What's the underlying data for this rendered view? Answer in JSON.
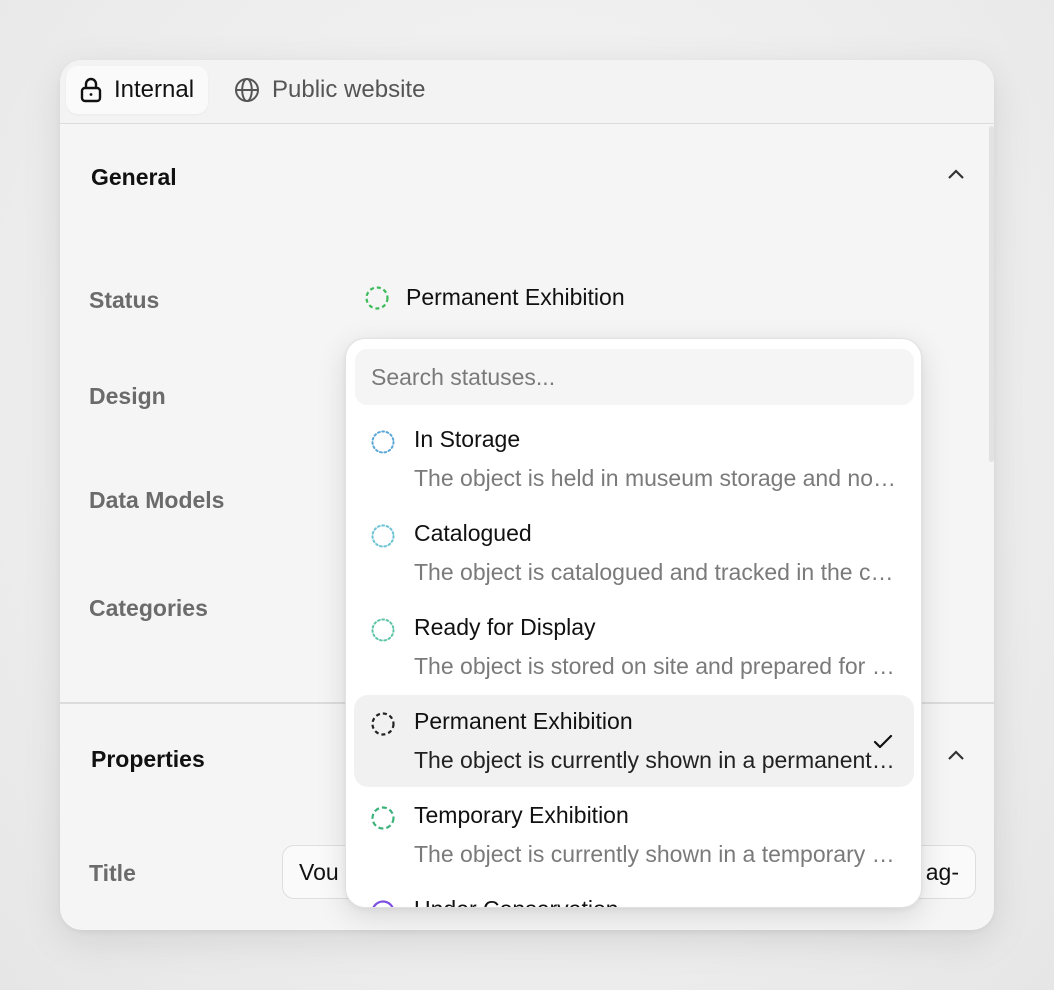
{
  "tabs": [
    {
      "label": "Internal",
      "icon": "lock-icon",
      "active": true
    },
    {
      "label": "Public website",
      "icon": "globe-icon",
      "active": false
    }
  ],
  "general": {
    "title": "General",
    "fields": {
      "status": "Status",
      "design": "Design",
      "data_models": "Data Models",
      "categories": "Categories"
    },
    "status_value": "Permanent Exhibition"
  },
  "properties": {
    "title": "Properties",
    "title_label": "Title",
    "title_value_start": "Vou",
    "title_value_end": "ag-"
  },
  "dropdown": {
    "search_placeholder": "Search statuses...",
    "options": [
      {
        "name": "In Storage",
        "desc": "The object is held in museum storage and not currently on view.",
        "color": "#5aa7d8",
        "selected": false
      },
      {
        "name": "Catalogued",
        "desc": "The object is catalogued and tracked in the collection system.",
        "color": "#6cc3d4",
        "selected": false
      },
      {
        "name": "Ready for Display",
        "desc": "The object is stored on site and prepared for display.",
        "color": "#5fc4a8",
        "selected": false
      },
      {
        "name": "Permanent Exhibition",
        "desc": "The object is currently shown in a permanent exhibition.",
        "color": "#222222",
        "selected": true
      },
      {
        "name": "Temporary Exhibition",
        "desc": "The object is currently shown in a temporary exhibition.",
        "color": "#3bb27a",
        "selected": false
      },
      {
        "name": "Under Conservation",
        "desc": "",
        "color": "#7b4fe0",
        "selected": false
      }
    ]
  },
  "colors": {
    "status_current": "#3dbb5a",
    "accent_purple": "#7b4fe0"
  }
}
